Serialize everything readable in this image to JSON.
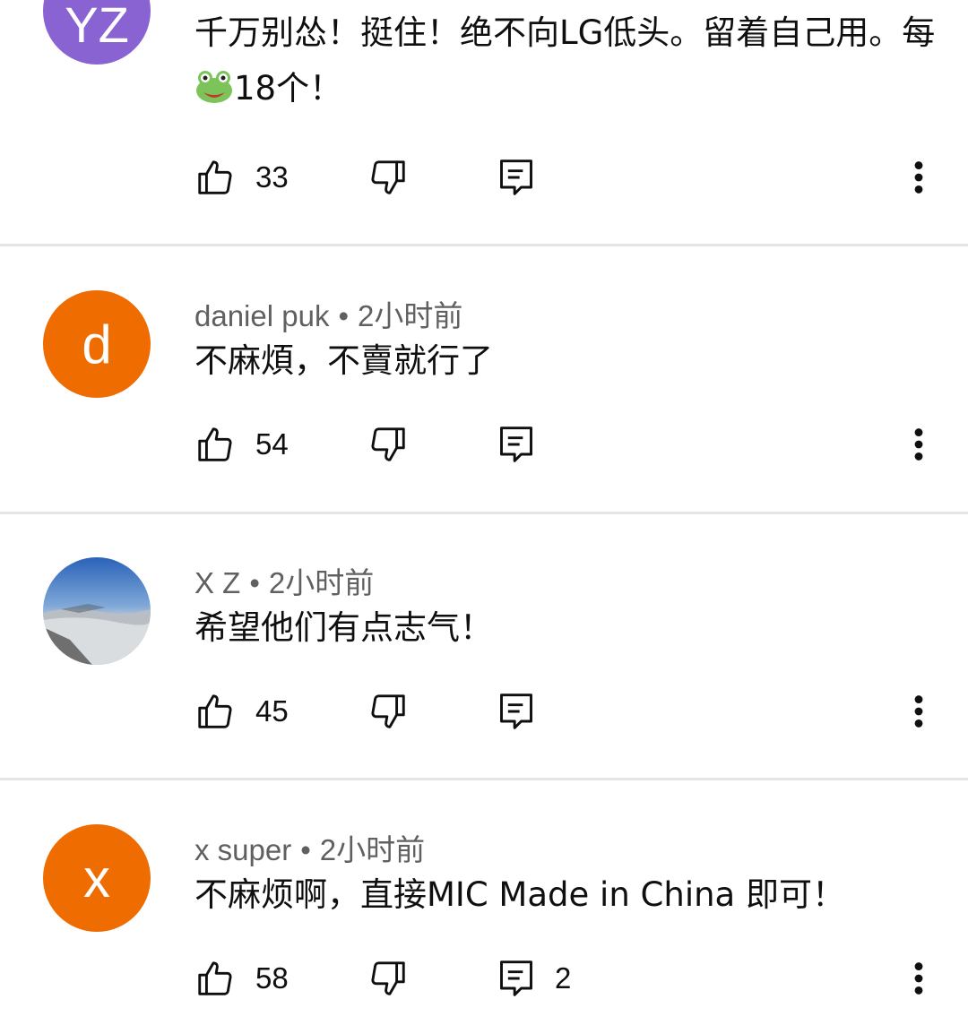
{
  "comments": [
    {
      "avatar_letter": "YZ",
      "avatar_color": "#8a63d2",
      "author": "",
      "time": "",
      "text_before_emoji": "千万别怂！挺住！绝不向LG低头。留着自己用。每",
      "emoji": "frog-emoji",
      "text_after_emoji": "18个！",
      "likes": "33",
      "replies": ""
    },
    {
      "avatar_letter": "d",
      "avatar_color": "#ef6c00",
      "author": "daniel puk",
      "time": "2小时前",
      "text": "不麻煩，不賣就行了",
      "likes": "54",
      "replies": ""
    },
    {
      "avatar_letter": "",
      "avatar_color": "#5b8fc7",
      "author": "X Z",
      "time": "2小时前",
      "text": "希望他们有点志气！",
      "likes": "45",
      "replies": ""
    },
    {
      "avatar_letter": "x",
      "avatar_color": "#ef6c00",
      "author": "x super",
      "time": "2小时前",
      "text": "不麻烦啊，直接MIC Made in China 即可！",
      "likes": "58",
      "replies": "2"
    }
  ],
  "meta_separator": "•",
  "icons": {
    "like": "thumbs-up-icon",
    "dislike": "thumbs-down-icon",
    "reply": "comment-icon",
    "more": "more-vert-icon"
  }
}
